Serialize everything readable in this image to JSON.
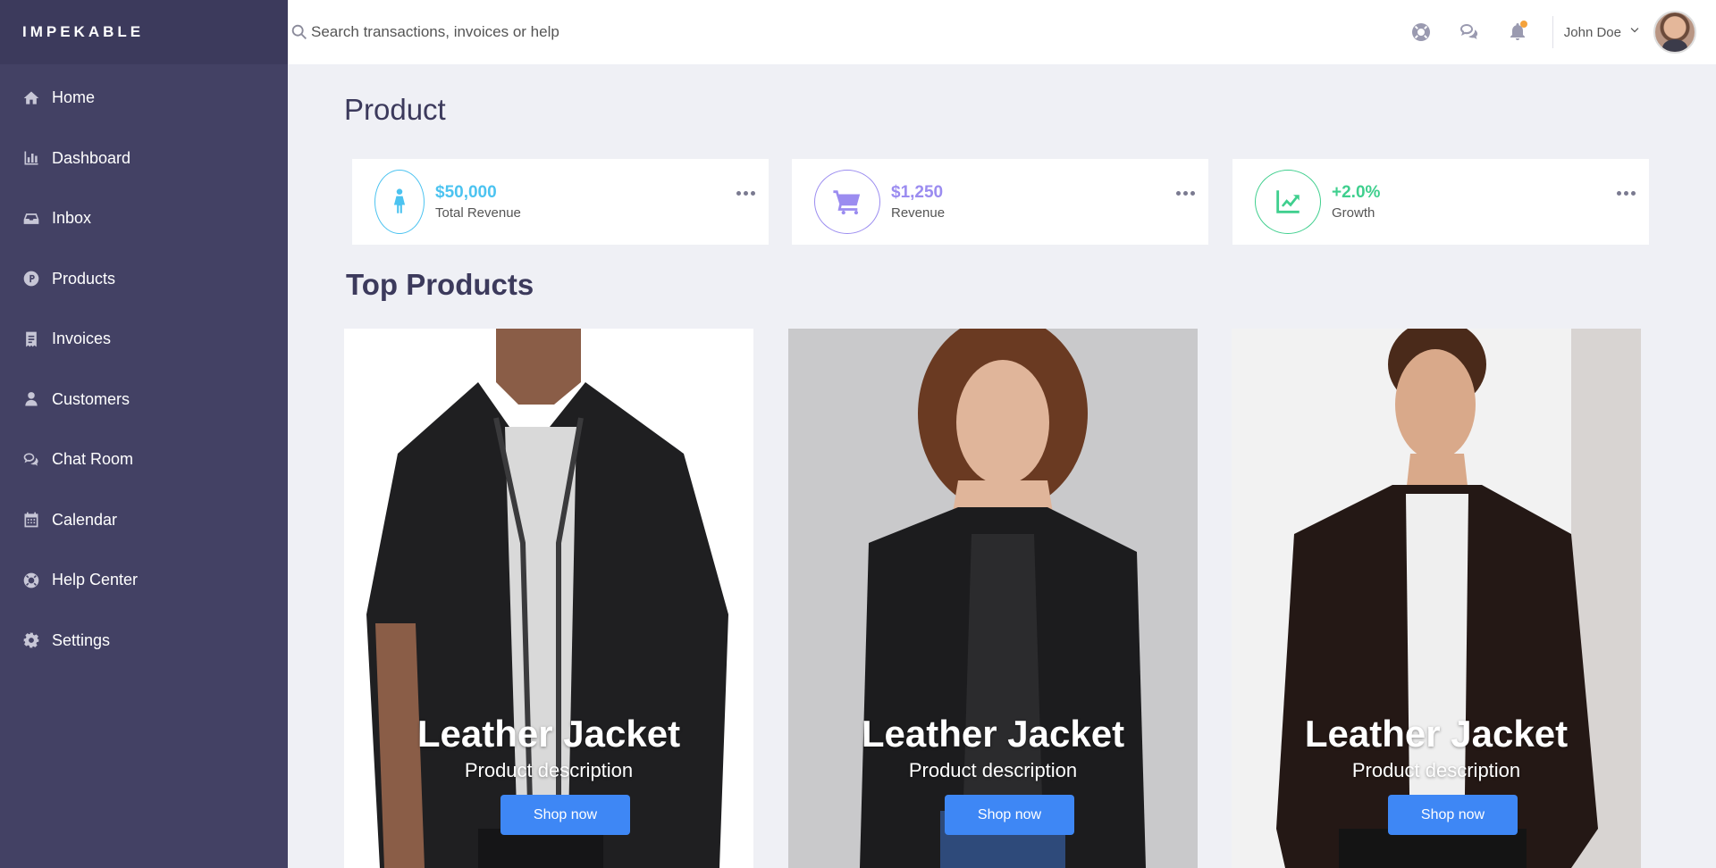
{
  "brand": "IMPEKABLE",
  "sidebar": {
    "items": [
      {
        "label": "Home",
        "icon": "home-icon"
      },
      {
        "label": "Dashboard",
        "icon": "bar-chart-icon"
      },
      {
        "label": "Inbox",
        "icon": "inbox-icon"
      },
      {
        "label": "Products",
        "icon": "product-icon"
      },
      {
        "label": "Invoices",
        "icon": "receipt-icon"
      },
      {
        "label": "Customers",
        "icon": "user-icon"
      },
      {
        "label": "Chat Room",
        "icon": "chat-icon"
      },
      {
        "label": "Calendar",
        "icon": "calendar-icon"
      },
      {
        "label": "Help Center",
        "icon": "lifebuoy-icon"
      },
      {
        "label": "Settings",
        "icon": "gear-icon"
      }
    ]
  },
  "header": {
    "search_placeholder": "Search transactions, invoices or help",
    "user_name": "John Doe"
  },
  "page": {
    "title": "Product",
    "stats": [
      {
        "value": "$50,000",
        "label": "Total Revenue",
        "color": "#4cc3f0",
        "icon": "person-icon"
      },
      {
        "value": "$1,250",
        "label": "Revenue",
        "color": "#9b8cf0",
        "icon": "cart-icon"
      },
      {
        "value": "+2.0%",
        "label": "Growth",
        "color": "#3fcf8e",
        "icon": "trend-icon"
      }
    ],
    "section_title": "Top Products",
    "products": [
      {
        "title": "Leather Jacket",
        "description": "Product description",
        "button": "Shop now"
      },
      {
        "title": "Leather Jacket",
        "description": "Product description",
        "button": "Shop now"
      },
      {
        "title": "Leather Jacket",
        "description": "Product description",
        "button": "Shop now"
      }
    ]
  },
  "colors": {
    "sidebar_bg": "#434164",
    "accent": "#3e87f5",
    "page_bg": "#eff0f5"
  }
}
